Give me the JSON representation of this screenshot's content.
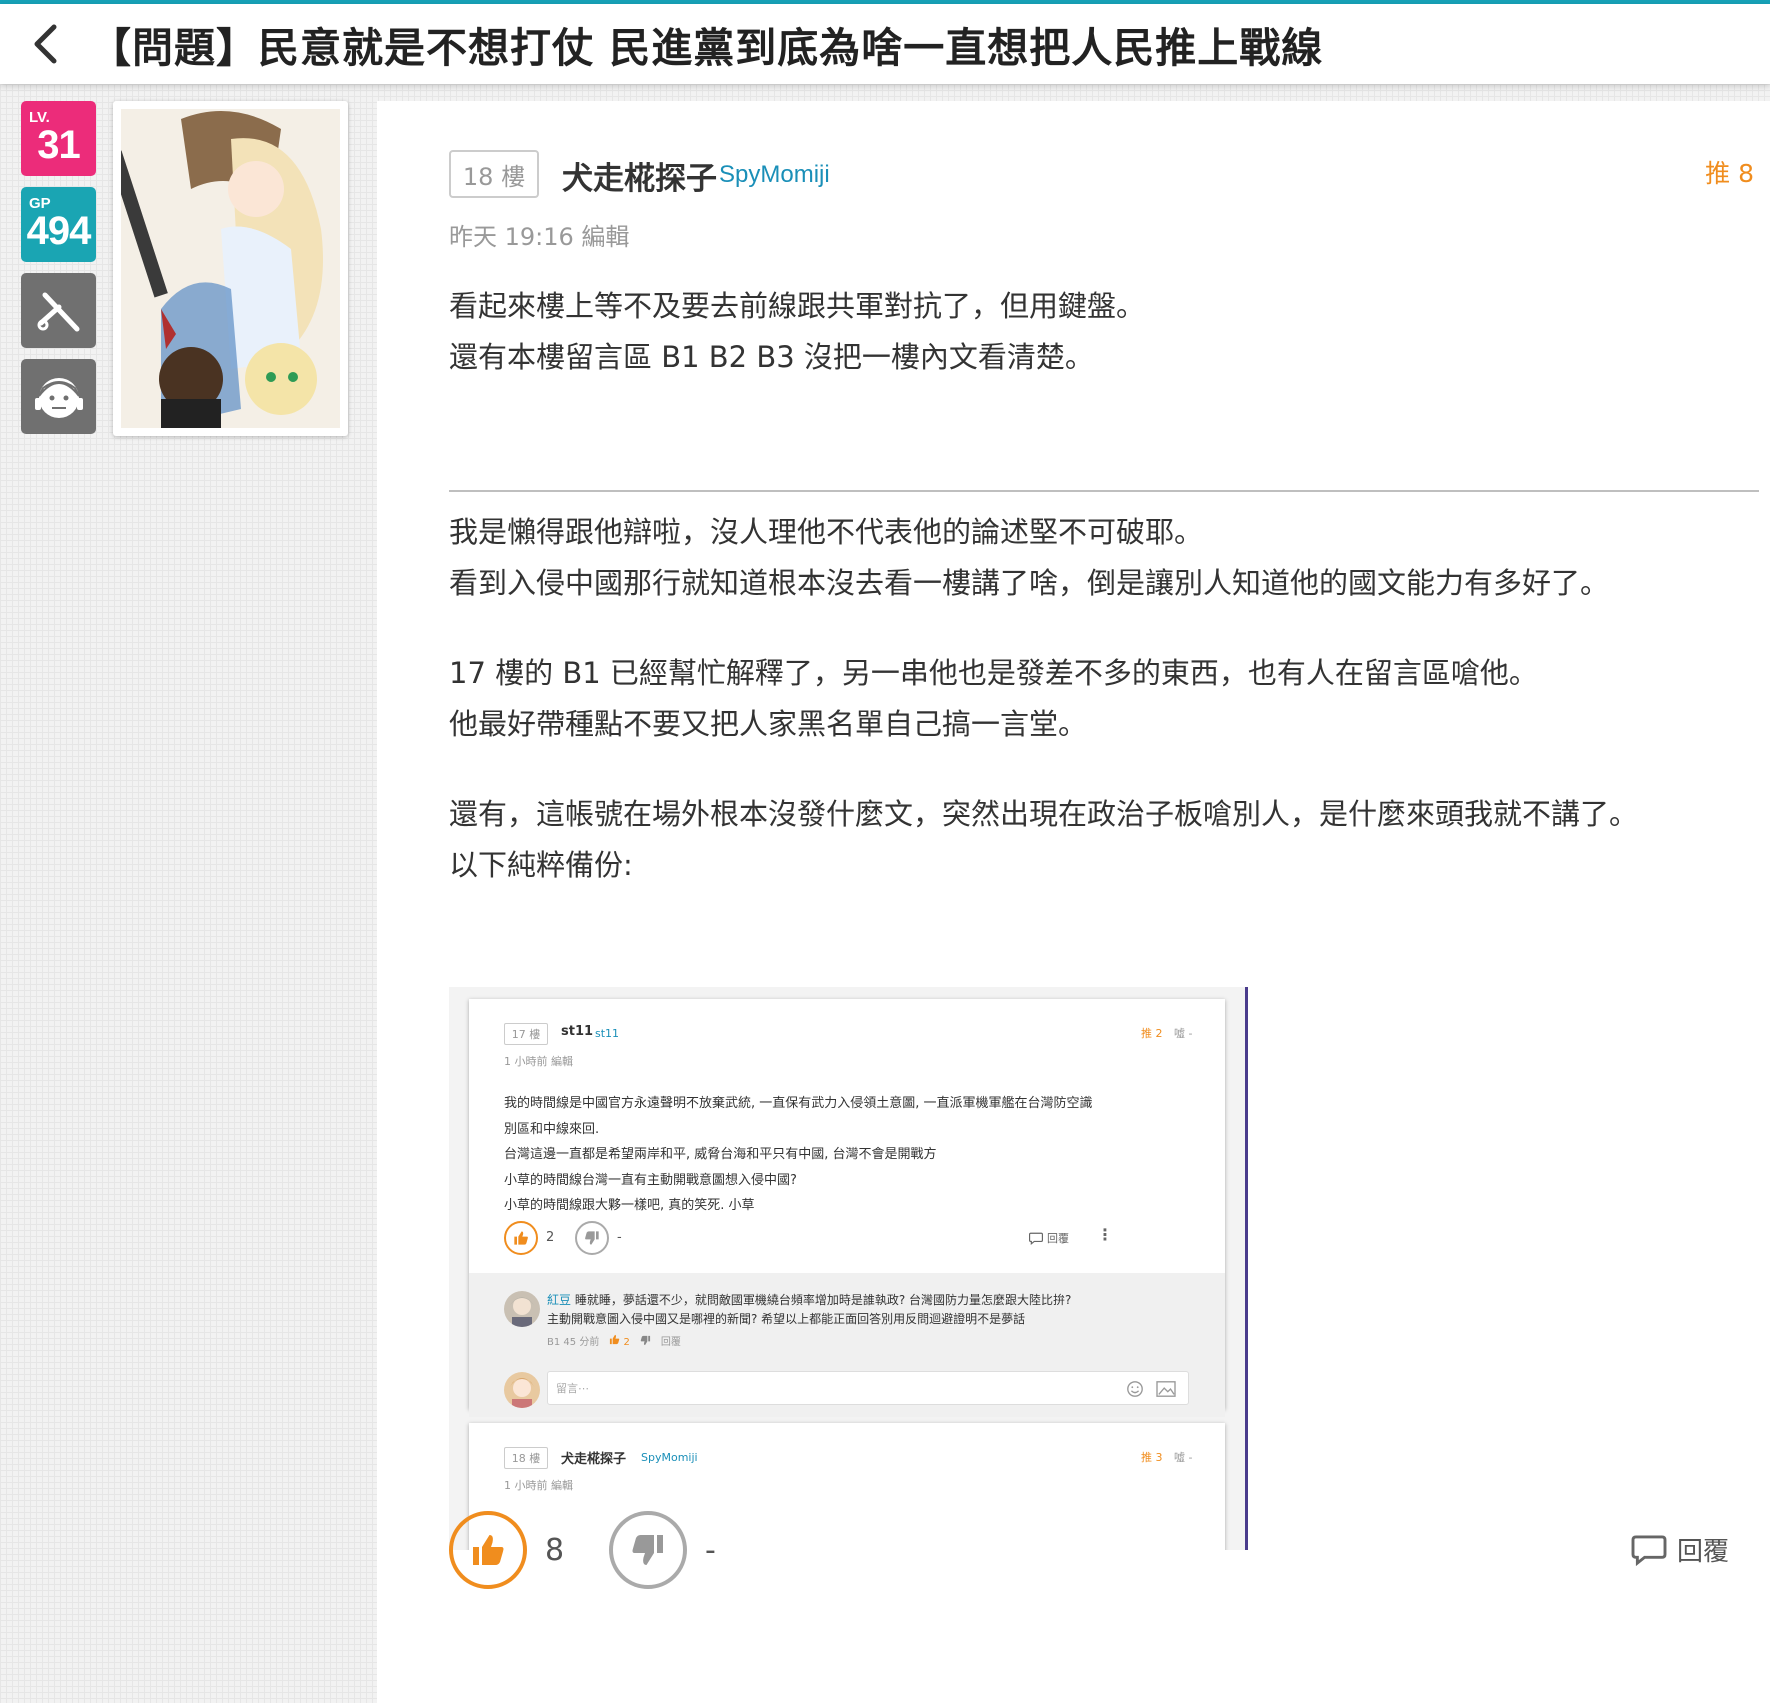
{
  "header": {
    "title": "【問題】民意就是不想打仗 民進黨到底為啥一直想把人民推上戰線"
  },
  "user": {
    "level_label": "LV.",
    "level": "31",
    "gp_label": "GP",
    "gp": "494"
  },
  "post": {
    "floor": "18 樓",
    "author": "犬走椛探子",
    "author_id": "SpyMomiji",
    "push": "推 8",
    "time": "昨天 19:16 編輯",
    "paragraphs": [
      [
        "看起來樓上等不及要去前線跟共軍對抗了，但用鍵盤。",
        "還有本樓留言區 B1 B2 B3 沒把一樓內文看清楚。"
      ],
      [
        "我是懶得跟他辯啦，沒人理他不代表他的論述堅不可破耶。",
        "看到入侵中國那行就知道根本沒去看一樓講了啥，倒是讓別人知道他的國文能力有多好了。"
      ],
      [
        "17 樓的 B1 已經幫忙解釋了，另一串他也是發差不多的東西，也有人在留言區嗆他。",
        "他最好帶種點不要又把人家黑名單自己搞一言堂。"
      ],
      [
        "還有，這帳號在場外根本沒發什麼文，突然出現在政治子板嗆別人，是什麼來頭我就不講了。",
        "以下純粹備份:"
      ]
    ],
    "like_count": "8",
    "dislike_count": "-",
    "reply_label": "回覆"
  },
  "screenshot": {
    "floor": "17 樓",
    "author": "st11",
    "author_id": "st11",
    "push": "推 2",
    "boo": "噓 -",
    "time": "1 小時前 編輯",
    "lines": [
      "我的時間線是中國官方永遠聲明不放棄武統, 一直保有武力入侵領土意圖, 一直派軍機軍艦在台灣防空識",
      "別區和中線來回.",
      "台灣這邊一直都是希望兩岸和平, 威脅台海和平只有中國, 台灣不會是開戰方",
      "小草的時間線台灣一直有主動開戰意圖想入侵中國?",
      "小草的時間線跟大夥一樣吧, 真的笑死. 小草"
    ],
    "like_count": "2",
    "dislike_count": "-",
    "reply_label": "回覆",
    "comment": {
      "name": "紅豆",
      "line1": "睡就睡，夢話還不少，就問敵國軍機繞台頻率增加時是誰執政? 台灣國防力量怎麼跟大陸比拚?",
      "line2": "主動開戰意圖入侵中國又是哪裡的新聞? 希望以上都能正面回答別用反問迴避證明不是夢話",
      "floor": "B1",
      "time": "45 分前",
      "likes": "2",
      "reply": "回覆"
    },
    "input_placeholder": "留言⋯",
    "next": {
      "floor": "18 樓",
      "author": "犬走椛探子",
      "author_id": "SpyMomiji",
      "push": "推 3",
      "boo": "噓 -",
      "time": "1 小時前 編輯"
    }
  },
  "colors": {
    "accent": "#17a2b8",
    "level_badge": "#ec2c7a",
    "gp_badge": "#1aa5b3",
    "push": "#f08d1e",
    "link": "#1a8fb8"
  },
  "icons": [
    "back-arrow-icon",
    "tool-icon",
    "face-icon",
    "thumb-up-icon",
    "thumb-down-icon",
    "comment-icon",
    "more-icon",
    "emoji-icon",
    "image-icon"
  ]
}
